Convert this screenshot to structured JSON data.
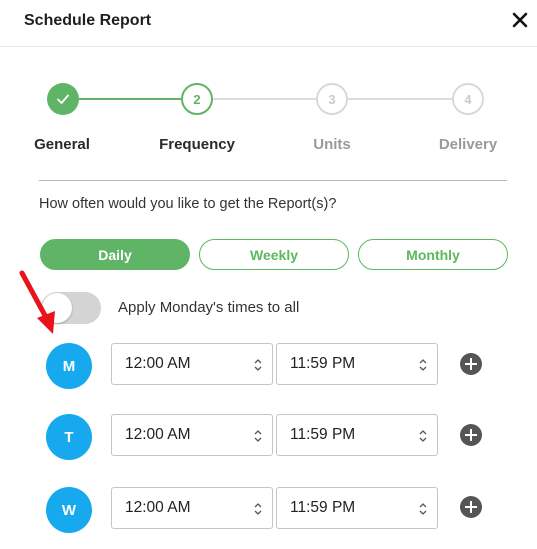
{
  "dialog": {
    "title": "Schedule Report",
    "close_icon": "close-icon"
  },
  "stepper": {
    "steps": [
      {
        "number": "1",
        "label": "General",
        "state": "completed"
      },
      {
        "number": "2",
        "label": "Frequency",
        "state": "active"
      },
      {
        "number": "3",
        "label": "Units",
        "state": "pending"
      },
      {
        "number": "4",
        "label": "Delivery",
        "state": "pending"
      }
    ]
  },
  "frequency": {
    "question": "How often would you like to get the Report(s)?",
    "options": [
      "Daily",
      "Weekly",
      "Monthly"
    ],
    "selected": "Daily"
  },
  "apply_all": {
    "label": "Apply Monday's times to all",
    "enabled": false
  },
  "days": [
    {
      "letter": "M",
      "start": "12:00 AM",
      "end": "11:59 PM"
    },
    {
      "letter": "T",
      "start": "12:00 AM",
      "end": "11:59 PM"
    },
    {
      "letter": "W",
      "start": "12:00 AM",
      "end": "11:59 PM"
    }
  ],
  "colors": {
    "green": "#5fb565",
    "step_pending": "#d9d9d9",
    "day_blue": "#16a9ee",
    "annotation_red": "#e8131b"
  }
}
